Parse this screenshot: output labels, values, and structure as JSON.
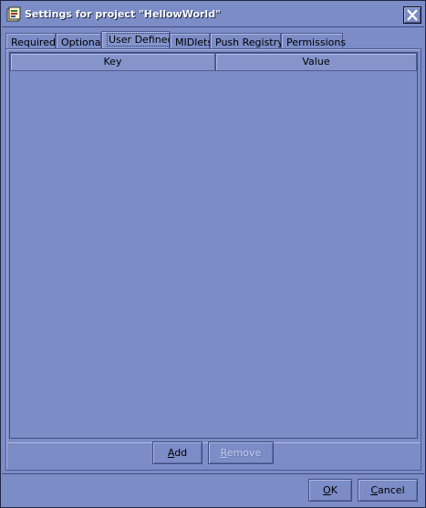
{
  "window": {
    "title": "Settings for project \"HellowWorld\"",
    "icon": "project-settings-icon",
    "close_icon": "close-icon"
  },
  "tabs": [
    {
      "label": "Required",
      "active": false
    },
    {
      "label": "Optional",
      "active": false
    },
    {
      "label": "User Defined",
      "active": true
    },
    {
      "label": "MIDlets",
      "active": false
    },
    {
      "label": "Push Registry",
      "active": false
    },
    {
      "label": "Permissions",
      "active": false
    }
  ],
  "table": {
    "columns": [
      "Key",
      "Value"
    ],
    "rows": []
  },
  "panel_buttons": {
    "add": {
      "mnemonic": "A",
      "rest": "dd",
      "enabled": true
    },
    "remove": {
      "mnemonic": "R",
      "rest": "emove",
      "enabled": false
    }
  },
  "dialog_buttons": {
    "ok": {
      "mnemonic": "O",
      "rest": "K"
    },
    "cancel": {
      "mnemonic": "C",
      "rest": "ancel"
    }
  },
  "colors": {
    "background": "#7b8cc6",
    "border": "#1e2745",
    "title_text": "#ffffff",
    "disabled_text": "#c4cbe8"
  }
}
